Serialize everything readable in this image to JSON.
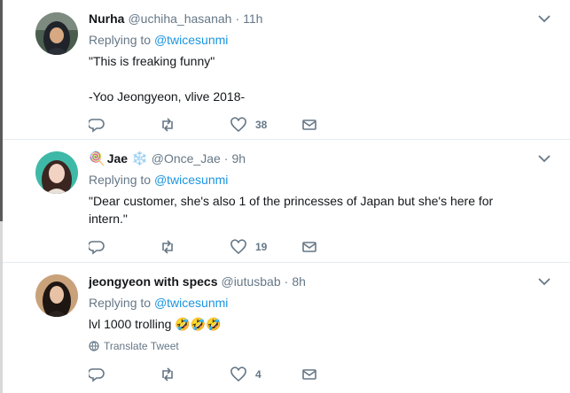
{
  "tweets": [
    {
      "name": "Nurha",
      "handle": "@uchiha_hasanah",
      "time": "11h",
      "replying_prefix": "Replying to",
      "replying_to": "@twicesunmi",
      "lines": [
        "\"This is freaking funny\"",
        "",
        "-Yoo Jeongyeon, vlive 2018-"
      ],
      "likes": "38",
      "avatar_icon": "hijab-woman-avatar"
    },
    {
      "name_emoji": "🍭",
      "name": "Jae",
      "name_suffix": "❄️",
      "handle": "@Once_Jae",
      "time": "9h",
      "replying_prefix": "Replying to",
      "replying_to": "@twicesunmi",
      "lines": [
        "\"Dear customer, she's also 1 of the princesses of Japan but she's here for intern.\""
      ],
      "likes": "19",
      "avatar_icon": "woman-avatar"
    },
    {
      "name": "jeongyeon with specs",
      "handle": "@iutusbab",
      "time": "8h",
      "replying_prefix": "Replying to",
      "replying_to": "@twicesunmi",
      "lines": [
        "lvl 1000 trolling 🤣🤣🤣"
      ],
      "translate": "Translate Tweet",
      "likes": "4",
      "avatar_icon": "woman-dark-hair-avatar"
    }
  ],
  "dot": "·",
  "colors": {
    "link": "#1b95e0",
    "muted": "#657786",
    "text": "#14171a",
    "divider": "#e6ecf0"
  }
}
